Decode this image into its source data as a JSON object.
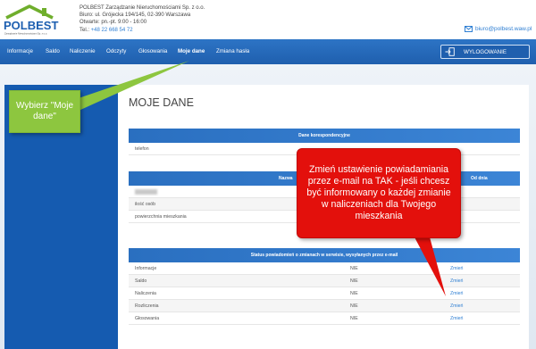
{
  "brand": {
    "name": "POLBEST",
    "tagline": "Zarządzanie Nieruchomościami Sp. z o.o."
  },
  "company": {
    "line1": "POLBEST Zarządzanie Nieruchomościami Sp. z o.o.",
    "line2": "Biuro: ul. Grójecka 194/145, 02-390 Warszawa",
    "line3": "Otwarte: pn.-pt. 9:00 - 16:00",
    "phone_label": "Tel.: ",
    "phone": "+48 22 668 54 72",
    "email": "biuro@polbest.waw.pl"
  },
  "nav": {
    "items": [
      "Informacje",
      "Saldo",
      "Naliczenie",
      "Odczyty",
      "Głosowania",
      "Moje dane",
      "Zmiana hasła"
    ],
    "active": "Moje dane",
    "logout": "WYLOGOWANIE"
  },
  "page": {
    "title": "MOJE DANE"
  },
  "sections": {
    "correspondence": {
      "header": "Dane korespondencyjne",
      "rows": [
        {
          "label": "telefon"
        }
      ]
    },
    "apartment": {
      "col_name": "Nazwa",
      "col_from": "Od dnia",
      "rows": [
        {
          "label": "ilość osób"
        },
        {
          "label": "powierzchnia mieszkania"
        }
      ]
    },
    "notifications": {
      "header": "Status powiadomień o zmianach w serwisie, wysyłanych przez e-mail",
      "rows": [
        {
          "label": "Informacje",
          "status": "NIE",
          "action": "Zmień"
        },
        {
          "label": "Saldo",
          "status": "NIE",
          "action": "Zmień"
        },
        {
          "label": "Naliczenia",
          "status": "NIE",
          "action": "Zmień"
        },
        {
          "label": "Rozliczenia",
          "status": "NIE",
          "action": "Zmień"
        },
        {
          "label": "Głosowania",
          "status": "NIE",
          "action": "Zmień"
        }
      ]
    }
  },
  "callouts": {
    "green": "Wybierz \"Moje dane\"",
    "red": "Zmień ustawienie powiadamiania przez e-mail na TAK - jeśli chcesz być informowany o każdej zmianie w naliczeniach dla Twojego mieszkania"
  },
  "colors": {
    "nav": "#1f5fae",
    "sidebar": "#155bb0",
    "link": "#2f7fd3",
    "callout_green": "#8dc63f",
    "callout_red": "#e3100c"
  },
  "icons": {
    "logo": "house-logo-icon",
    "email": "envelope-icon",
    "logout": "logout-icon"
  }
}
